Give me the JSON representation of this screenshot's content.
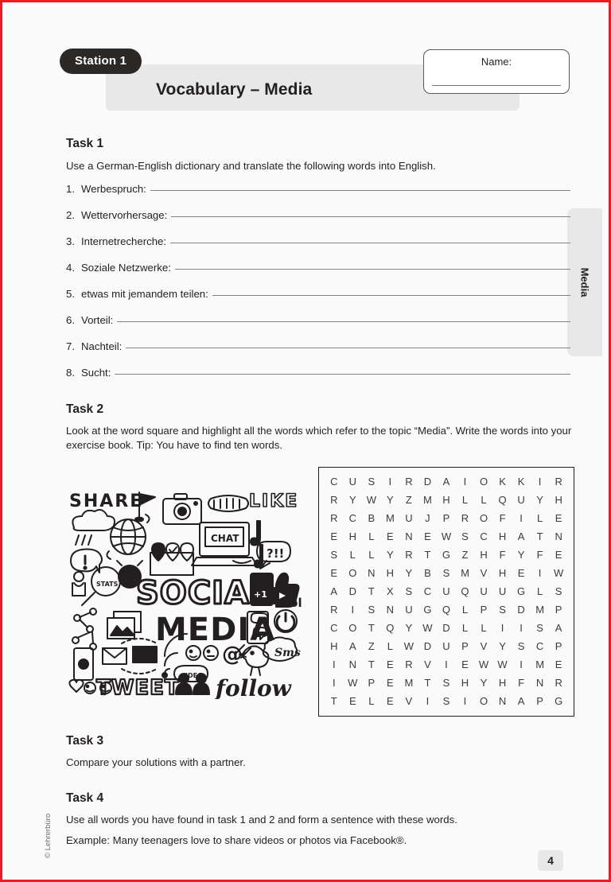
{
  "page": {
    "station_badge": "Station 1",
    "title": "Vocabulary – Media",
    "name_label": "Name:",
    "side_tab": "Media",
    "copyright": "© Lehrerbüro",
    "page_number": "4",
    "border_color": "#ee1b24",
    "band_color": "#e8e8e8",
    "badge_color": "#2b2927"
  },
  "task1": {
    "heading": "Task 1",
    "intro": "Use a German-English dictionary and translate the following words into English.",
    "items": [
      {
        "num": "1.",
        "label": "Werbespruch:"
      },
      {
        "num": "2.",
        "label": "Wettervorhersage:"
      },
      {
        "num": "3.",
        "label": "Internetrecherche:"
      },
      {
        "num": "4.",
        "label": "Soziale Netzwerke:"
      },
      {
        "num": "5.",
        "label": "etwas mit jemandem teilen:"
      },
      {
        "num": "6.",
        "label": "Vorteil:"
      },
      {
        "num": "7.",
        "label": "Nachteil:"
      },
      {
        "num": "8.",
        "label": "Sucht:"
      }
    ]
  },
  "task2": {
    "heading": "Task 2",
    "intro": "Look at the word square and highlight all the words which refer to the topic “Media”. Write the words into your exercise book. Tip: You have to find ten words.",
    "doodle_words": [
      "SHARE",
      "LIKE",
      "CHAT",
      "?!!",
      "STATS",
      "+1",
      "SOCIAL",
      "MEDIA",
      "IDEA",
      "TWEET",
      "follow",
      "Sms",
      "@"
    ],
    "word_square": {
      "rows": 13,
      "cols": 13,
      "grid": [
        [
          "C",
          "U",
          "S",
          "I",
          "R",
          "D",
          "A",
          "I",
          "O",
          "K",
          "K",
          "I",
          "R"
        ],
        [
          "R",
          "Y",
          "W",
          "Y",
          "Z",
          "M",
          "H",
          "L",
          "L",
          "Q",
          "U",
          "Y",
          "H"
        ],
        [
          "R",
          "C",
          "B",
          "M",
          "U",
          "J",
          "P",
          "R",
          "O",
          "F",
          "I",
          "L",
          "E"
        ],
        [
          "E",
          "H",
          "L",
          "E",
          "N",
          "E",
          "W",
          "S",
          "C",
          "H",
          "A",
          "T",
          "N"
        ],
        [
          "S",
          "L",
          "L",
          "Y",
          "R",
          "T",
          "G",
          "Z",
          "H",
          "F",
          "Y",
          "F",
          "E"
        ],
        [
          "E",
          "O",
          "N",
          "H",
          "Y",
          "B",
          "S",
          "M",
          "V",
          "H",
          "E",
          "I",
          "W"
        ],
        [
          "A",
          "D",
          "T",
          "X",
          "S",
          "C",
          "U",
          "Q",
          "U",
          "U",
          "G",
          "L",
          "S"
        ],
        [
          "R",
          "I",
          "S",
          "N",
          "U",
          "G",
          "Q",
          "L",
          "P",
          "S",
          "D",
          "M",
          "P"
        ],
        [
          "C",
          "O",
          "T",
          "Q",
          "Y",
          "W",
          "D",
          "L",
          "L",
          "I",
          "I",
          "S",
          "A"
        ],
        [
          "H",
          "A",
          "Z",
          "L",
          "W",
          "D",
          "U",
          "P",
          "V",
          "Y",
          "S",
          "C",
          "P"
        ],
        [
          "I",
          "N",
          "T",
          "E",
          "R",
          "V",
          "I",
          "E",
          "W",
          "W",
          "I",
          "M",
          "E"
        ],
        [
          "I",
          "W",
          "P",
          "E",
          "M",
          "T",
          "S",
          "H",
          "Y",
          "H",
          "F",
          "N",
          "R"
        ],
        [
          "T",
          "E",
          "L",
          "E",
          "V",
          "I",
          "S",
          "I",
          "O",
          "N",
          "A",
          "P",
          "G"
        ]
      ]
    }
  },
  "task3": {
    "heading": "Task 3",
    "intro": "Compare your solutions with a partner."
  },
  "task4": {
    "heading": "Task 4",
    "line1": "Use all words you have found in task 1 and 2 and form a sentence with these words.",
    "line2": "Example: Many teenagers love to share videos or photos via Facebook®."
  }
}
